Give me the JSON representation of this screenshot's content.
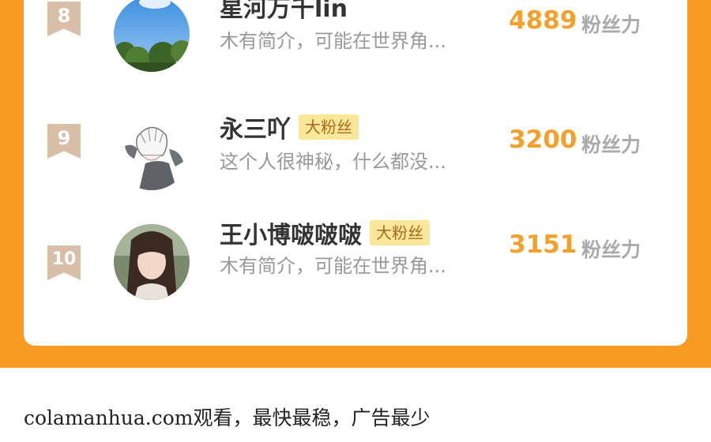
{
  "ranking": [
    {
      "rank": "8",
      "name": "星河万千lin",
      "badge": "",
      "intro": "木有简介，可能在世界角...",
      "score": "4889",
      "unit": "粉丝力",
      "avatar": "sky-trees-avatar"
    },
    {
      "rank": "9",
      "name": "永三吖",
      "badge": "大粉丝",
      "intro": "这个人很神秘，什么都没...",
      "score": "3200",
      "unit": "粉丝力",
      "avatar": "anime-boy-avatar"
    },
    {
      "rank": "10",
      "name": "王小博啵啵啵",
      "badge": "大粉丝",
      "intro": "木有简介，可能在世界角...",
      "score": "3151",
      "unit": "粉丝力",
      "avatar": "girl-photo-avatar"
    }
  ],
  "footer": {
    "text": "colamanhua.com观看，最快最稳，广告最少"
  },
  "colors": {
    "frame": "#f99b22",
    "score": "#f5a02a",
    "badge_bg": "#fbe79a",
    "rank_flag": "#d9bfa7"
  }
}
